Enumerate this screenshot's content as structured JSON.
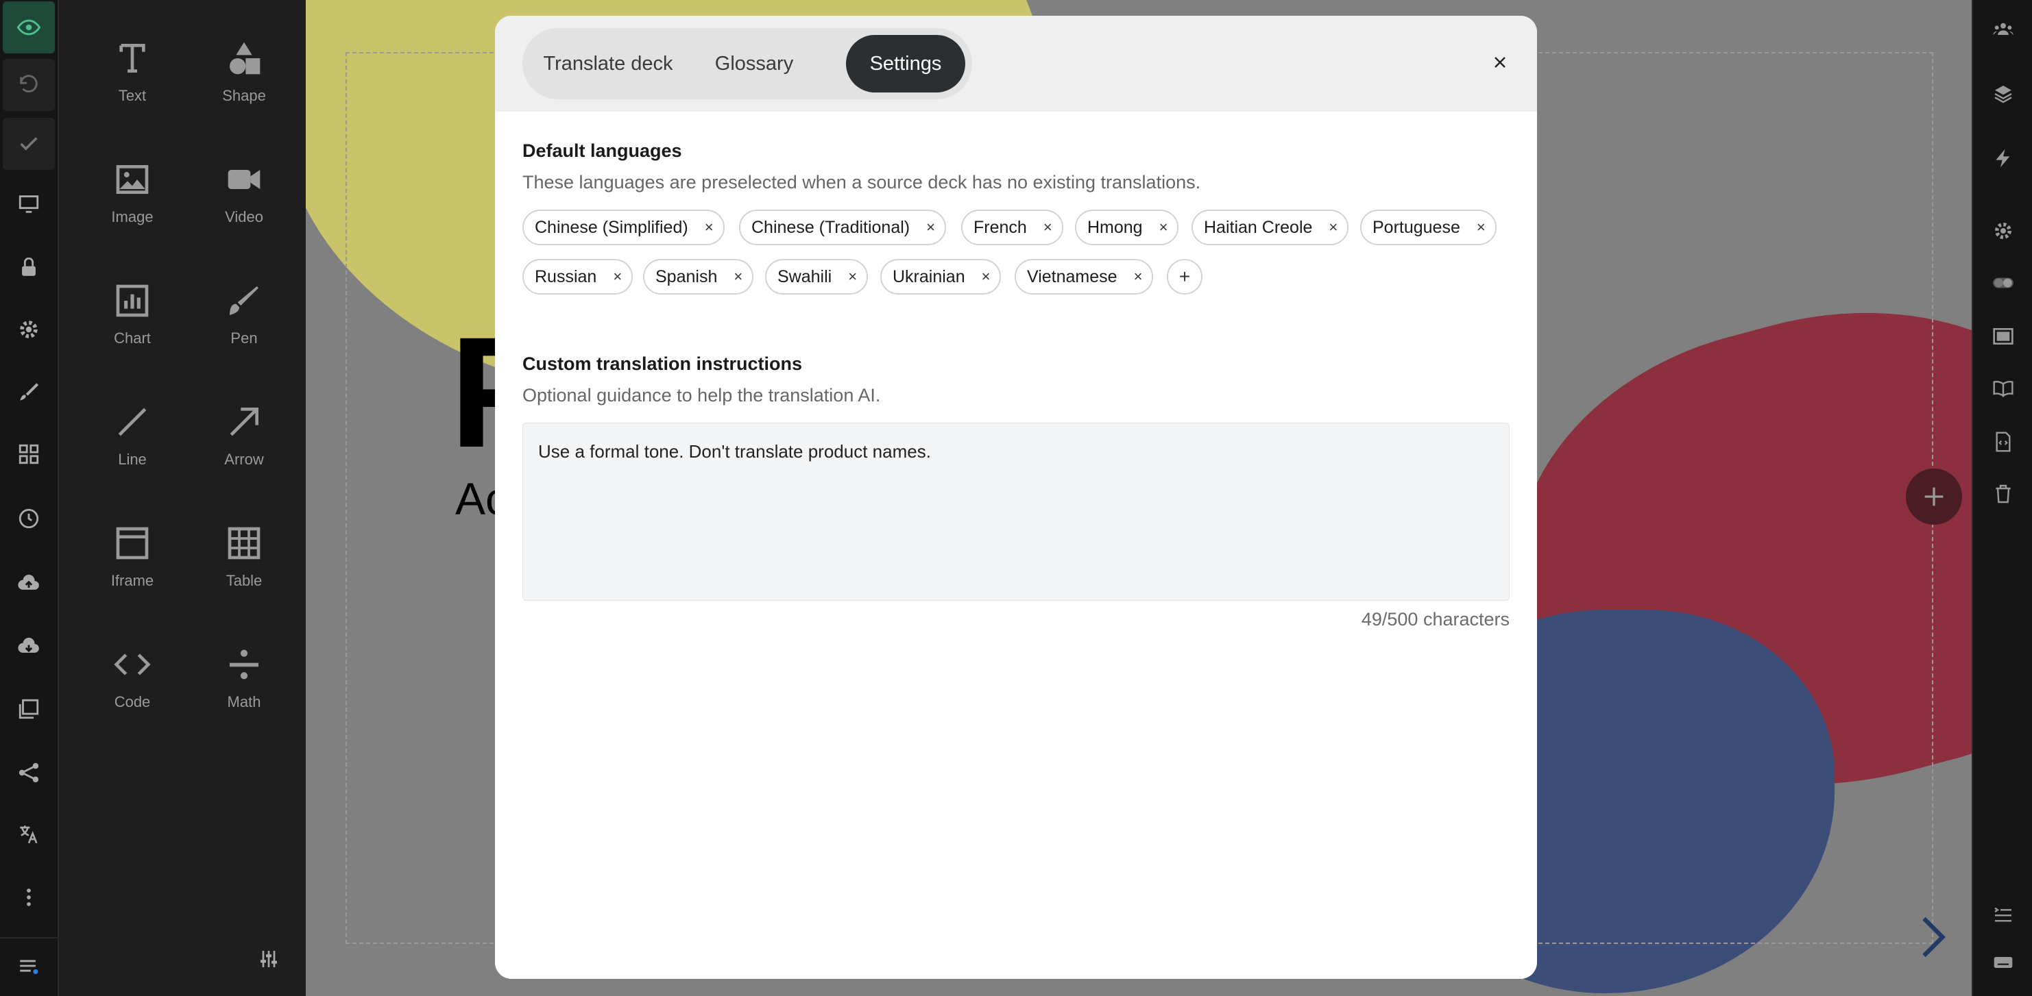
{
  "toolbar_left": {
    "items": [
      "eye-icon",
      "undo-icon",
      "check-icon",
      "monitor-icon",
      "lock-icon",
      "gear-icon",
      "brush-icon",
      "grid-icon",
      "clock-icon",
      "cloud-upload-icon",
      "cloud-download-icon",
      "images-icon",
      "share-icon",
      "translate-icon",
      "more-vertical-icon",
      "menu-icon"
    ]
  },
  "insert_panel": {
    "tools": [
      {
        "label": "Text",
        "icon": "text-icon"
      },
      {
        "label": "Shape",
        "icon": "shape-icon"
      },
      {
        "label": "Image",
        "icon": "image-icon"
      },
      {
        "label": "Video",
        "icon": "video-icon"
      },
      {
        "label": "Chart",
        "icon": "chart-icon"
      },
      {
        "label": "Pen",
        "icon": "pen-icon"
      },
      {
        "label": "Line",
        "icon": "line-icon"
      },
      {
        "label": "Arrow",
        "icon": "arrow-icon"
      },
      {
        "label": "Iframe",
        "icon": "iframe-icon"
      },
      {
        "label": "Table",
        "icon": "table-icon"
      },
      {
        "label": "Code",
        "icon": "code-icon"
      },
      {
        "label": "Math",
        "icon": "math-icon"
      }
    ]
  },
  "canvas": {
    "title_fragment": "F",
    "subtitle_fragment": "Ac",
    "colors": {
      "yellow": "#c9c46a",
      "red": "#8c2f3f",
      "blue": "#3c4d78",
      "bg": "#808080"
    }
  },
  "modal": {
    "tabs": [
      {
        "label": "Translate deck",
        "active": false
      },
      {
        "label": "Glossary",
        "active": false
      },
      {
        "label": "Settings",
        "active": true
      }
    ],
    "close_icon": "close-icon",
    "default_languages": {
      "title": "Default languages",
      "description": "These languages are preselected when a source deck has no existing translations.",
      "languages": [
        "Chinese (Simplified)",
        "Chinese (Traditional)",
        "French",
        "Hmong",
        "Haitian Creole",
        "Portuguese",
        "Russian",
        "Spanish",
        "Swahili",
        "Ukrainian",
        "Vietnamese"
      ],
      "remove_glyph": "×",
      "add_glyph": "+"
    },
    "custom_instructions": {
      "title": "Custom translation instructions",
      "description": "Optional guidance to help the translation AI.",
      "value": "Use a formal tone. Don't translate product names.",
      "char_count": "49/500 characters"
    }
  },
  "toolbar_right": {
    "items": [
      "team-icon",
      "layers-icon",
      "lightning-icon",
      "gear-icon",
      "toggle-icon",
      "presentation-icon",
      "book-icon",
      "code-file-icon",
      "trash-icon",
      "list-indent-icon",
      "keyboard-icon"
    ]
  }
}
